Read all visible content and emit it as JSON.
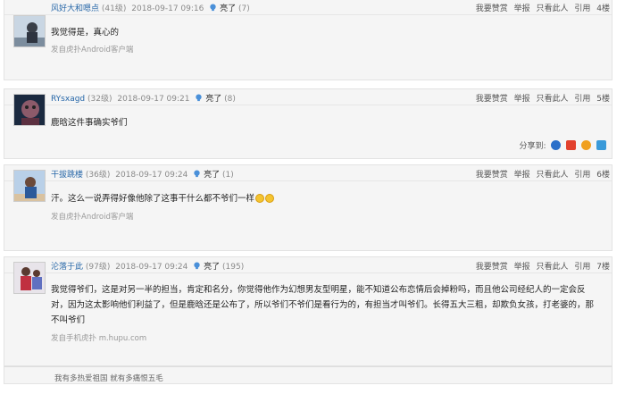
{
  "posts": [
    {
      "username": "风好大和嗯点",
      "level": "(41级)",
      "time": "2018-09-17 09:16",
      "light_label": "亮了",
      "light_count": "(7)",
      "content": "我觉得是，真心的",
      "source": "发自虎扑Android客户端",
      "floor": "4楼"
    },
    {
      "username": "RYsxagd",
      "level": "(32级)",
      "time": "2018-09-17 09:21",
      "light_label": "亮了",
      "light_count": "(8)",
      "content": "鹿晗这件事确实爷们",
      "share_label": "分享到:",
      "floor": "5楼"
    },
    {
      "username": "干拔跳楼",
      "level": "(36级)",
      "time": "2018-09-17 09:24",
      "light_label": "亮了",
      "light_count": "(1)",
      "content": "汗。这么一说弄得好像他除了这事干什么都不爷们一样",
      "source": "发自虎扑Android客户端",
      "floor": "6楼"
    },
    {
      "username": "沦落于此",
      "level": "(97级)",
      "time": "2018-09-17 09:24",
      "light_label": "亮了",
      "light_count": "(195)",
      "content": "我觉得爷们，这是对另一半的担当，肯定和名分，你觉得他作为幻想男友型明星，能不知道公布恋情后会掉粉吗，而且他公司经纪人的一定会反对，因为这太影响他们利益了，但是鹿晗还是公布了，所以爷们不爷们是看行为的，有担当才叫爷们。长得五大三粗，却欺负女孩，打老婆的，那不叫爷们",
      "source": "发自手机虎扑 m.hupu.com",
      "floor": "7楼"
    }
  ],
  "ops": {
    "recommend": "我要赞赏",
    "report": "举报",
    "only_author": "只看此人",
    "quote": "引用"
  },
  "signature": "我有多热爱祖国 就有多痛恨五毛",
  "colors": {
    "username": "#2767a8",
    "light_icon": "#4a90d9",
    "emoji": "#f4c430"
  },
  "icons": [
    "light-bulb-icon",
    "smile-emoji-icon",
    "share-qzone-icon",
    "share-weibo-icon",
    "share-renren-icon",
    "share-qq-icon"
  ]
}
